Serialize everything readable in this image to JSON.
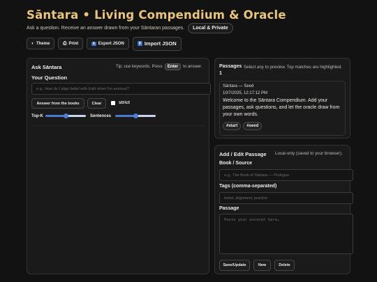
{
  "header": {
    "title": "Sāntara • Living Compendium & Oracle",
    "subtitle": "Ask a question. Receive an answer drawn from your Sāntaran passages.",
    "badge": "Local & Private"
  },
  "toolbar": {
    "theme": "Theme",
    "print": "Print",
    "export": "Export JSON",
    "import": "Import JSON"
  },
  "ask": {
    "title": "Ask Sāntara",
    "tip_prefix": "Tip: use keywords. Press",
    "tip_key": "Enter",
    "tip_suffix": "to answer.",
    "question_label": "Your Question",
    "question_placeholder": "e.g., How do I align belief with truth when I'm anxious?",
    "answer_button": "Answer from the books",
    "clear_button": "Clear",
    "strict_label": "strict",
    "topk_label": "Top-K",
    "sentences_label": "Sentences",
    "topk_level": 0.5,
    "sentences_level": 0.5
  },
  "passages": {
    "title": "Passages",
    "count": "1",
    "hint": "Select any to preview. Top matches are highlighted.",
    "items": [
      {
        "source": "Sāntara — Seed",
        "date": "10/7/2025, 12:17:12 PM",
        "text": "Welcome to the Sāntara Compendium. Add your passages, ask questions, and let the oracle draw from your own words.",
        "tags": [
          "#start",
          "#seed"
        ]
      }
    ]
  },
  "edit": {
    "title": "Add / Edit Passage",
    "hint": "Local-only (saved to your browser).",
    "book_label": "Book / Source",
    "book_placeholder": "e.g., The Book of Sāntara — Prologue",
    "tags_label": "Tags (comma-separated)",
    "tags_placeholder": "belief, alignment, practice",
    "passage_label": "Passage",
    "passage_placeholder": "Paste your excerpt here…",
    "save_button": "Save/Update",
    "new_button": "New",
    "delete_button": "Delete"
  },
  "colors": {
    "background": "#121212",
    "accent": "#e9c57a",
    "slider": "#4d7fd6"
  },
  "icons": {
    "theme": "half-moon-icon",
    "print": "printer-icon",
    "export": "download-box-icon",
    "import": "upload-box-icon"
  }
}
